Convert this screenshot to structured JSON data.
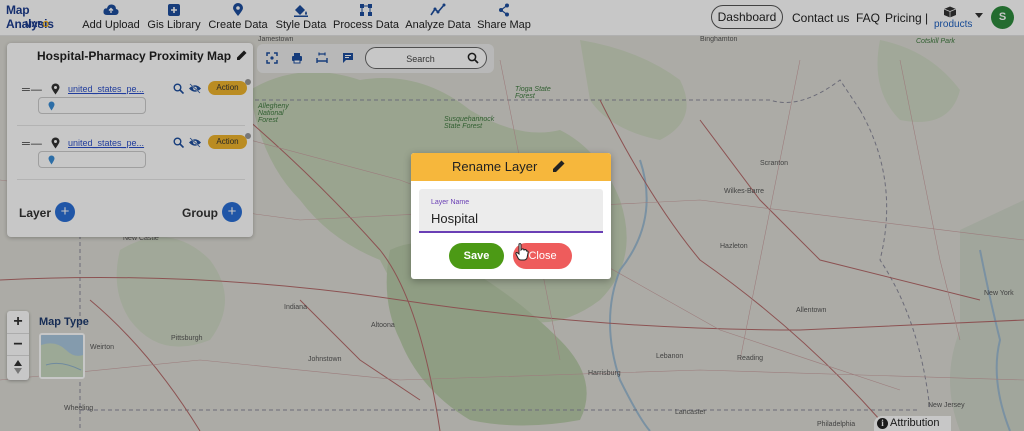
{
  "app": {
    "logo_line1": "Map Analysis",
    "logo_line2a": "MAP",
    "logo_line2b": "O"
  },
  "toolbar": [
    {
      "label": "Add Upload",
      "icon": "cloud-upload-icon"
    },
    {
      "label": "Gis Library",
      "icon": "library-add-icon"
    },
    {
      "label": "Create Data",
      "icon": "location-pin-icon"
    },
    {
      "label": "Style Data",
      "icon": "paint-bucket-icon"
    },
    {
      "label": "Process Data",
      "icon": "process-nodes-icon"
    },
    {
      "label": "Analyze Data",
      "icon": "analytics-icon"
    },
    {
      "label": "Share Map",
      "icon": "share-icon"
    }
  ],
  "nav": {
    "dashboard": "Dashboard",
    "contact": "Contact us",
    "faq": "FAQ",
    "pricing": "Pricing |",
    "products": "products",
    "avatar_initial": "S"
  },
  "panel": {
    "title": "Hospital-Pharmacy Proximity Map",
    "layers": [
      {
        "name": "united_states_pe...",
        "action": "Action"
      },
      {
        "name": "united_states_pe...",
        "action": "Action"
      }
    ],
    "layer_label": "Layer",
    "group_label": "Group"
  },
  "map_toolbar": {
    "search_placeholder": "Search"
  },
  "map_controls": {
    "zoom_in": "+",
    "zoom_out": "−",
    "map_type_label": "Map Type"
  },
  "attribution": "Attribution",
  "places": [
    {
      "name": "Jamestown",
      "green": false
    },
    {
      "name": "Binghamton",
      "green": false
    },
    {
      "name": "Cotskill Park",
      "green": true
    },
    {
      "name": "Tioga State Forest",
      "green": true
    },
    {
      "name": "Allegheny National Forest",
      "green": true
    },
    {
      "name": "Susquehannock State Forest",
      "green": true
    },
    {
      "name": "Scranton",
      "green": false
    },
    {
      "name": "Wilkes-Barre",
      "green": false
    },
    {
      "name": "Hazleton",
      "green": false
    },
    {
      "name": "Indiana",
      "green": false
    },
    {
      "name": "Altoona",
      "green": false
    },
    {
      "name": "Johnstown",
      "green": false
    },
    {
      "name": "Pittsburgh",
      "green": false
    },
    {
      "name": "Weirton",
      "green": false
    },
    {
      "name": "Wheeling",
      "green": false
    },
    {
      "name": "New Castle",
      "green": false
    },
    {
      "name": "Harrisburg",
      "green": false
    },
    {
      "name": "Lebanon",
      "green": false
    },
    {
      "name": "Reading",
      "green": false
    },
    {
      "name": "Allentown",
      "green": false
    },
    {
      "name": "New York",
      "green": false
    },
    {
      "name": "Lancaster",
      "green": false
    },
    {
      "name": "Philadelphia",
      "green": false
    },
    {
      "name": "New Jersey",
      "green": false
    }
  ],
  "dialog": {
    "title": "Rename Layer",
    "field_label": "Layer Name",
    "field_value": "Hospital",
    "save": "Save",
    "close": "Close"
  }
}
